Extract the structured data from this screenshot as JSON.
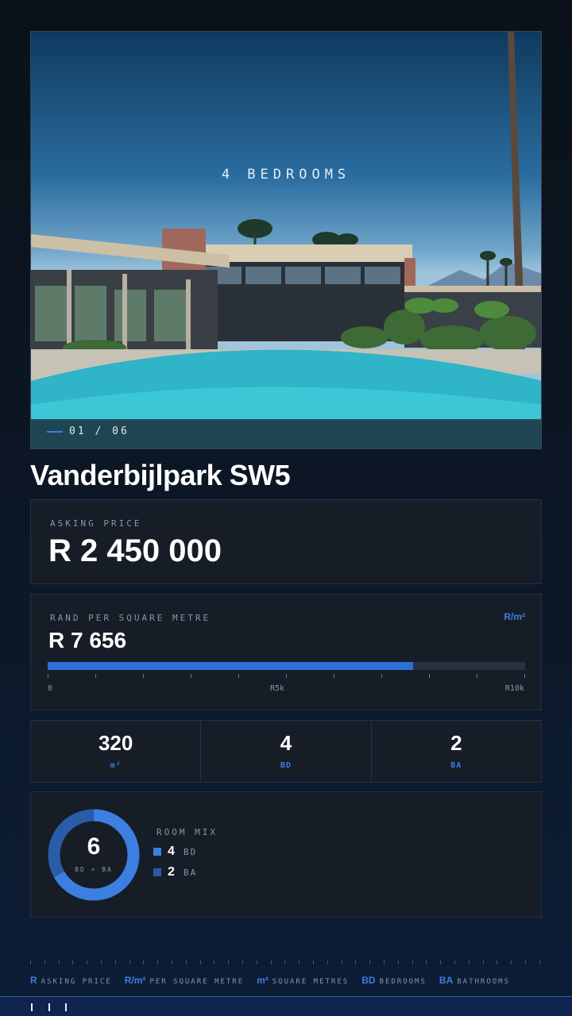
{
  "hero": {
    "title": "4 BEDROOMS",
    "counter": "01 / 06",
    "image": "photo of a mid-century modern house with a swimming pool and palm trees"
  },
  "listing": {
    "address": "Vanderbijlpark SW5"
  },
  "price": {
    "label": "ASKING PRICE",
    "value": "R 2 450 000"
  },
  "rate": {
    "label": "RAND PER SQUARE METRE",
    "unit": "R/m²",
    "value": "R 7 656",
    "fill_fraction": 0.7656,
    "scale": [
      "0",
      "R5k",
      "R10k"
    ]
  },
  "stats": [
    {
      "value": "320",
      "caption": "m²"
    },
    {
      "value": "4",
      "caption": "BD"
    },
    {
      "value": "2",
      "caption": "BA"
    }
  ],
  "room_mix": {
    "label": "ROOM MIX",
    "total": "6",
    "total_caption": "BD + BA",
    "items": [
      {
        "value": "4",
        "label": "BD",
        "color": "#3b7fe0"
      },
      {
        "value": "2",
        "label": "BA",
        "color": "#2b5ca8"
      }
    ]
  },
  "legend": [
    {
      "key": "R",
      "text": "ASKING PRICE"
    },
    {
      "key": "R/m²",
      "text": "PER SQUARE METRE"
    },
    {
      "key": "m²",
      "text": "SQUARE METRES"
    },
    {
      "key": "BD",
      "text": "BEDROOMS"
    },
    {
      "key": "BA",
      "text": "BATHROOMS"
    }
  ],
  "colors": {
    "accent": "#3b7fe0",
    "card": "#171d27",
    "background": "#0c1624"
  }
}
